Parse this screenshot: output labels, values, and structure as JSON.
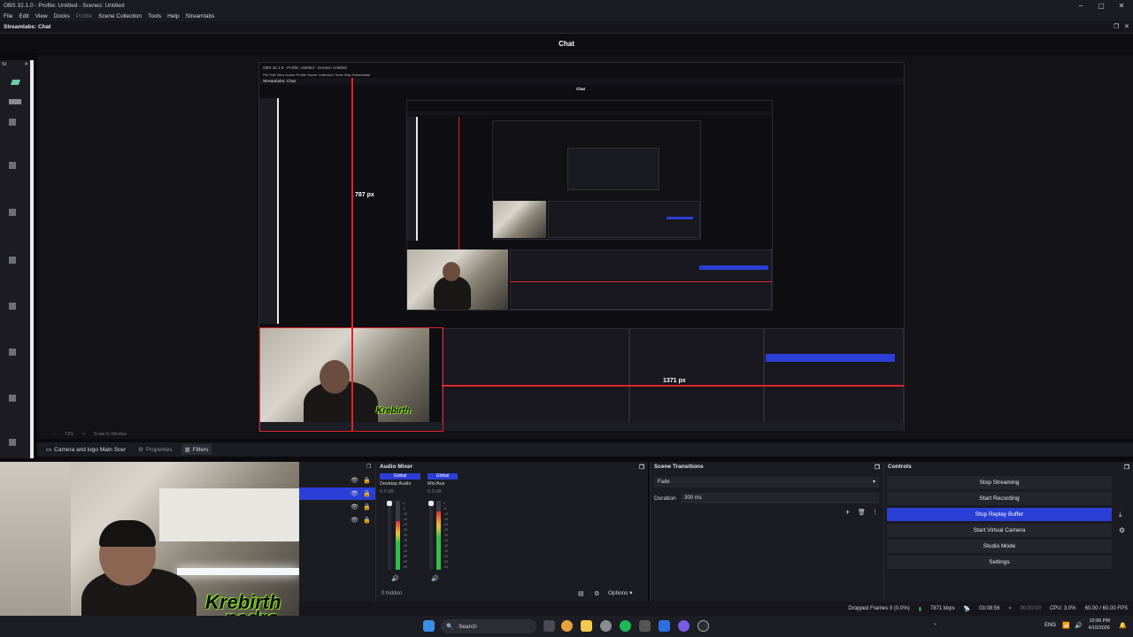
{
  "window": {
    "title": "OBS 32.1.0 - Profile: Untitled - Scenes: Untitled",
    "controls": {
      "minimize": "–",
      "maximize": "▢",
      "close": "✕"
    }
  },
  "menu": [
    "File",
    "Edit",
    "View",
    "Docks",
    "Profile",
    "Scene Collection",
    "Tools",
    "Help",
    "Streamlabs"
  ],
  "dock": {
    "label": "Streamlabs: Chat",
    "title": "Chat"
  },
  "left_dock": {
    "label": "St",
    "close": "✕"
  },
  "preview": {
    "zoom": "73%",
    "scale_mode": "Scale to Window",
    "nested_title": "OBS 32.1.0 - Profile: Untitled - Scenes: Untitled",
    "nested_chat": "Chat",
    "height_label": "787 px",
    "width_label": "1371 px",
    "nested_dock_label": "Streamlabs: Chat"
  },
  "source_toolbar": {
    "source_name": "Camera and logo Main Scer",
    "properties": "Properties",
    "filters": "Filters"
  },
  "webcam": {
    "logo_line1": "rebirth",
    "logo_line2": "pedro",
    "logo_k": "K"
  },
  "audio_mixer": {
    "title": "Audio Mixer",
    "channels": [
      {
        "global": "Global",
        "name": "Desktop Audio",
        "db": "0.0 dB",
        "level": 0.7
      },
      {
        "global": "Global",
        "name": "Mic/Aux",
        "db": "0.0 dB",
        "level": 0.85
      }
    ],
    "scale": [
      "0",
      "-5",
      "-10",
      "-15",
      "-20",
      "-25",
      "-30",
      "-35",
      "-40",
      "-45",
      "-50",
      "-55",
      "-60"
    ],
    "hidden": "0 hidden",
    "options": "Options"
  },
  "scene_transitions": {
    "title": "Scene Transitions",
    "transition": "Fade",
    "duration_label": "Duration",
    "duration_value": "300 ms"
  },
  "controls": {
    "title": "Controls",
    "buttons": [
      "Stop Streaming",
      "Start Recording",
      "Stop Replay Buffer",
      "Start Virtual Camera",
      "Studio Mode",
      "Settings"
    ]
  },
  "status": {
    "dropped": "Dropped Frames 0 (0.0%)",
    "bitrate": "7871 kbps",
    "stream_time": "03:08:56",
    "rec_time": "00:00:00",
    "cpu": "CPU: 3.0%",
    "fps": "60.00 / 60.00 FPS"
  },
  "taskbar": {
    "search": "Search",
    "lang": "ENG",
    "time": "10:56 PM",
    "date": "4/10/2026"
  },
  "colors": {
    "accent": "#2b3fd6",
    "measure": "#e0242b",
    "logo_green": "#8ddb2a"
  }
}
